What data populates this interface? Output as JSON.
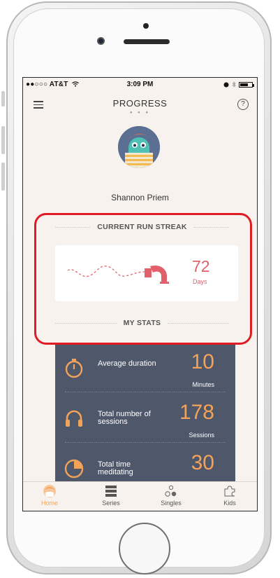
{
  "status_bar": {
    "carrier": "●●○○○ AT&T",
    "wifi_icon": "wifi-icon",
    "time": "3:09 PM",
    "right_icons": [
      "alarm-icon",
      "bluetooth-icon",
      "battery-icon"
    ]
  },
  "nav": {
    "title": "PROGRESS",
    "dots": "● ● ●",
    "menu_icon": "hamburger-icon",
    "help_label": "?"
  },
  "profile": {
    "name": "Shannon Priem",
    "avatar_icon": "avatar-character"
  },
  "streak": {
    "section_title": "CURRENT RUN STREAK",
    "value": "72",
    "unit": "Days",
    "accent_color": "#e0606c"
  },
  "stats": {
    "section_title": "MY STATS",
    "accent_color": "#f2a35a",
    "card_color": "#4f576b",
    "items": [
      {
        "icon": "stopwatch-icon",
        "label": "Average duration",
        "value": "10",
        "unit": "Minutes"
      },
      {
        "icon": "headphones-icon",
        "label": "Total number of sessions",
        "value": "178",
        "unit": "Sessions"
      },
      {
        "icon": "pie-clock-icon",
        "label": "Total time meditating",
        "value": "30",
        "unit": ""
      }
    ]
  },
  "tabs": [
    {
      "label": "Home",
      "icon": "home-face-icon",
      "active": true
    },
    {
      "label": "Series",
      "icon": "series-stack-icon",
      "active": false
    },
    {
      "label": "Singles",
      "icon": "singles-dots-icon",
      "active": false
    },
    {
      "label": "Kids",
      "icon": "puzzle-icon",
      "active": false
    }
  ]
}
